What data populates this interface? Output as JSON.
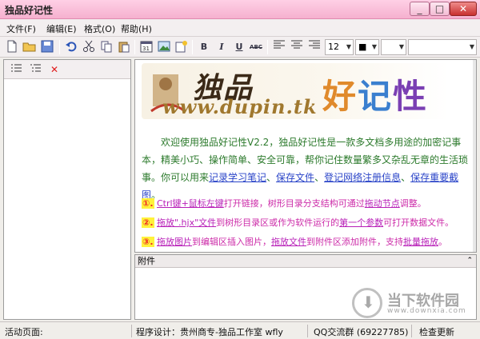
{
  "window": {
    "title": "独品好记性",
    "min": "_",
    "max": "□",
    "close": "✕"
  },
  "menu": [
    {
      "label": "文件(F)"
    },
    {
      "label": "编辑(E)"
    },
    {
      "label": "格式(O)"
    },
    {
      "label": "帮助(H)"
    }
  ],
  "toolbar": {
    "bold": "B",
    "italic": "I",
    "underline": "U",
    "strike": "ABC",
    "font_size": "12",
    "color_swatch": "■"
  },
  "logo": {
    "script_text": "独品",
    "url_text": "www.dupin.tk",
    "right_chars": [
      "好",
      "记",
      "性"
    ]
  },
  "intro": {
    "text_before": "欢迎使用独品好记性V2.2，独品好记性是一款多文档多用途的加密记事本，精美小巧、操作简单、安全可靠，帮你记住数量繁多又杂乱无章的生活琐事。你可以用来",
    "link1": "记录学习笔记",
    "sep1": "、",
    "link2": "保存文件",
    "sep2": "、",
    "link3": "登记网络注册信息",
    "sep3": "、",
    "link4": "保存重要截图",
    "end": "。"
  },
  "tips": [
    {
      "num": "①.",
      "parts": [
        {
          "t": "Ctrl键+鼠标左键",
          "link": true
        },
        {
          "t": "打开链接，树形目录分支结构可通过",
          "link": false
        },
        {
          "t": "拖动节点",
          "link": true
        },
        {
          "t": "调整。",
          "link": false
        }
      ]
    },
    {
      "num": "②.",
      "parts": [
        {
          "t": "拖放\".hjx\"文件",
          "link": true
        },
        {
          "t": "到树形目录区或作为软件运行的",
          "link": false
        },
        {
          "t": "第一个参数",
          "link": true
        },
        {
          "t": "可打开数据文件。",
          "link": false
        }
      ]
    },
    {
      "num": "③.",
      "parts": [
        {
          "t": "拖放图片",
          "link": true
        },
        {
          "t": "到编辑区插入图片，",
          "link": false
        },
        {
          "t": "拖放文件",
          "link": true
        },
        {
          "t": "到附件区添加附件，支持",
          "link": false
        },
        {
          "t": "批量拖放",
          "link": true
        },
        {
          "t": "。",
          "link": false
        }
      ]
    }
  ],
  "attachments": {
    "header": "附件",
    "collapse": "⌃"
  },
  "watermark": {
    "main": "当下软件园",
    "sub": "www.downxia.com"
  },
  "status": {
    "active_page": "活动页面:",
    "designer": "程序设计：贵州商专-独品工作室 wfly",
    "qq": "QQ交流群 (69227785)",
    "update": "检查更新"
  }
}
